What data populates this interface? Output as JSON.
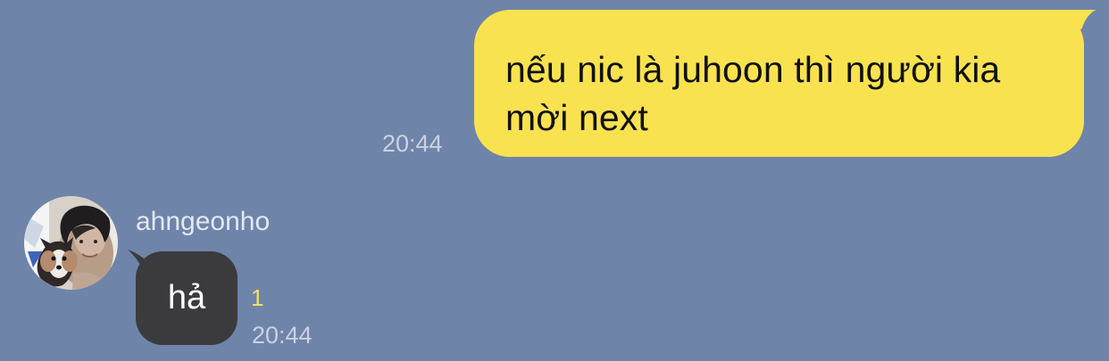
{
  "chat": {
    "messages": [
      {
        "direction": "outgoing",
        "text": "nếu nic là juhoon thì người kia mời next",
        "time": "20:44"
      },
      {
        "direction": "incoming",
        "sender": "ahngeonho",
        "text": "hả",
        "unread_count": "1",
        "time": "20:44",
        "avatar_icon": "profile-photo-avatar"
      }
    ]
  },
  "colors": {
    "background": "#6f84a9",
    "outgoing_bubble": "#f8e24f",
    "incoming_bubble": "#3b3b3d",
    "timestamp": "#c9d2e2",
    "unread_count": "#f4e35b"
  }
}
